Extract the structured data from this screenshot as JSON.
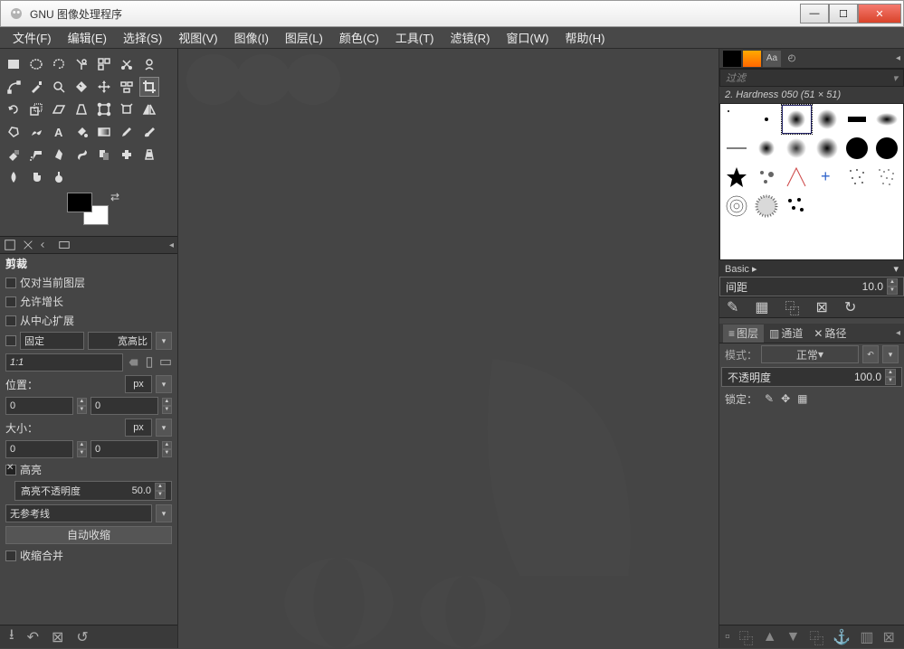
{
  "window": {
    "title": "GNU 图像处理程序"
  },
  "menu": [
    "文件(F)",
    "编辑(E)",
    "选择(S)",
    "视图(V)",
    "图像(I)",
    "图层(L)",
    "颜色(C)",
    "工具(T)",
    "滤镜(R)",
    "窗口(W)",
    "帮助(H)"
  ],
  "toolopts": {
    "title": "剪裁",
    "chk_current": "仅对当前图层",
    "chk_grow": "允许增长",
    "chk_center": "从中心扩展",
    "fixed_label": "固定",
    "aspect_label": "宽高比",
    "ratio": "1:1",
    "pos_label": "位置：",
    "unit_px": "px",
    "pos_x": "0",
    "pos_y": "0",
    "size_label": "大小：",
    "size_w": "0",
    "size_h": "0",
    "highlight": "高亮",
    "hl_opacity_label": "高亮不透明度",
    "hl_opacity": "50.0",
    "guides": "无参考线",
    "auto_shrink": "自动收缩",
    "shrink_merge": "收缩合并"
  },
  "brushes": {
    "filter_placeholder": "过滤",
    "selected": "2. Hardness 050 (51 × 51)",
    "preset": "Basic ▸",
    "spacing_label": "间距",
    "spacing": "10.0"
  },
  "layers": {
    "tab_layers": "图层",
    "tab_channels": "通道",
    "tab_paths": "路径",
    "mode_label": "模式：",
    "mode_value": "正常",
    "opacity_label": "不透明度",
    "opacity": "100.0",
    "lock_label": "锁定："
  }
}
